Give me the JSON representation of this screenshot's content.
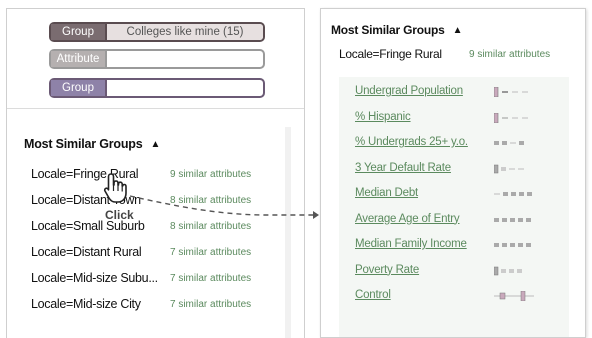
{
  "filters": [
    {
      "label": "Group",
      "value": "Colleges like mine (15)"
    },
    {
      "label": "Attribute",
      "value": ""
    },
    {
      "label": "Group",
      "value": ""
    }
  ],
  "groups_panel": {
    "title": "Most Similar Groups",
    "caret": "▲",
    "groups": [
      {
        "name": "Locale=Fringe Rural",
        "count": "9 similar attributes"
      },
      {
        "name": "Locale=Distant Town",
        "count": "8 similar attributes"
      },
      {
        "name": "Locale=Small Suburb",
        "count": "8 similar attributes"
      },
      {
        "name": "Locale=Distant Rural",
        "count": "7 similar attributes"
      },
      {
        "name": "Locale=Mid-size Subu...",
        "count": "7 similar attributes"
      },
      {
        "name": "Locale=Mid-size City",
        "count": "7 similar attributes"
      }
    ]
  },
  "annotation": {
    "click_label": "Click"
  },
  "detail_panel": {
    "title": "Most Similar Groups",
    "caret": "▲",
    "locale": "Locale=Fringe Rural",
    "count": "9 similar attributes",
    "attributes": [
      {
        "name": "Undergrad Population",
        "glyph": "tall-first"
      },
      {
        "name": "% Hispanic",
        "glyph": "tall-first"
      },
      {
        "name": "% Undergrads 25+ y.o.",
        "glyph": "boxes"
      },
      {
        "name": "3 Year Default Rate",
        "glyph": "mid-first"
      },
      {
        "name": "Median Debt",
        "glyph": "boxes-mid"
      },
      {
        "name": "Average Age of Entry",
        "glyph": "boxes"
      },
      {
        "name": "Median Family Income",
        "glyph": "boxes"
      },
      {
        "name": "Poverty Rate",
        "glyph": "mid-first"
      },
      {
        "name": "Control",
        "glyph": "spread"
      }
    ]
  },
  "colors": {
    "group_pill": "#7a6c70",
    "attribute_pill": "#b5b0b0",
    "group2_pill": "#8e82a8",
    "accent_green": "#5b8a5e"
  }
}
